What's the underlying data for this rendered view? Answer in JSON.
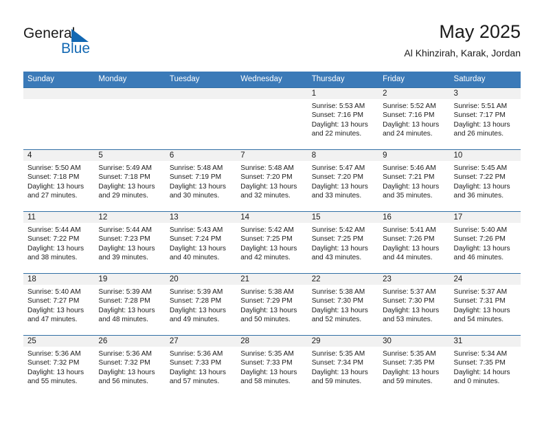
{
  "brand": {
    "name_part1": "General",
    "name_part2": "Blue",
    "flag_icon": "blue-triangle-flag-icon",
    "accent_color": "#1268b3"
  },
  "header": {
    "title": "May 2025",
    "subtitle": "Al Khinzirah, Karak, Jordan"
  },
  "theme": {
    "header_blue": "#3b7ab8",
    "row_border_blue": "#2e6da4",
    "day_band_gray": "#f1f1f1"
  },
  "calendar": {
    "weekday_headers": [
      "Sunday",
      "Monday",
      "Tuesday",
      "Wednesday",
      "Thursday",
      "Friday",
      "Saturday"
    ],
    "weeks": [
      [
        {
          "day": "",
          "empty": true
        },
        {
          "day": "",
          "empty": true
        },
        {
          "day": "",
          "empty": true
        },
        {
          "day": "",
          "empty": true
        },
        {
          "day": "1",
          "sunrise": "Sunrise: 5:53 AM",
          "sunset": "Sunset: 7:16 PM",
          "daylight1": "Daylight: 13 hours",
          "daylight2": "and 22 minutes."
        },
        {
          "day": "2",
          "sunrise": "Sunrise: 5:52 AM",
          "sunset": "Sunset: 7:16 PM",
          "daylight1": "Daylight: 13 hours",
          "daylight2": "and 24 minutes."
        },
        {
          "day": "3",
          "sunrise": "Sunrise: 5:51 AM",
          "sunset": "Sunset: 7:17 PM",
          "daylight1": "Daylight: 13 hours",
          "daylight2": "and 26 minutes."
        }
      ],
      [
        {
          "day": "4",
          "sunrise": "Sunrise: 5:50 AM",
          "sunset": "Sunset: 7:18 PM",
          "daylight1": "Daylight: 13 hours",
          "daylight2": "and 27 minutes."
        },
        {
          "day": "5",
          "sunrise": "Sunrise: 5:49 AM",
          "sunset": "Sunset: 7:18 PM",
          "daylight1": "Daylight: 13 hours",
          "daylight2": "and 29 minutes."
        },
        {
          "day": "6",
          "sunrise": "Sunrise: 5:48 AM",
          "sunset": "Sunset: 7:19 PM",
          "daylight1": "Daylight: 13 hours",
          "daylight2": "and 30 minutes."
        },
        {
          "day": "7",
          "sunrise": "Sunrise: 5:48 AM",
          "sunset": "Sunset: 7:20 PM",
          "daylight1": "Daylight: 13 hours",
          "daylight2": "and 32 minutes."
        },
        {
          "day": "8",
          "sunrise": "Sunrise: 5:47 AM",
          "sunset": "Sunset: 7:20 PM",
          "daylight1": "Daylight: 13 hours",
          "daylight2": "and 33 minutes."
        },
        {
          "day": "9",
          "sunrise": "Sunrise: 5:46 AM",
          "sunset": "Sunset: 7:21 PM",
          "daylight1": "Daylight: 13 hours",
          "daylight2": "and 35 minutes."
        },
        {
          "day": "10",
          "sunrise": "Sunrise: 5:45 AM",
          "sunset": "Sunset: 7:22 PM",
          "daylight1": "Daylight: 13 hours",
          "daylight2": "and 36 minutes."
        }
      ],
      [
        {
          "day": "11",
          "sunrise": "Sunrise: 5:44 AM",
          "sunset": "Sunset: 7:22 PM",
          "daylight1": "Daylight: 13 hours",
          "daylight2": "and 38 minutes."
        },
        {
          "day": "12",
          "sunrise": "Sunrise: 5:44 AM",
          "sunset": "Sunset: 7:23 PM",
          "daylight1": "Daylight: 13 hours",
          "daylight2": "and 39 minutes."
        },
        {
          "day": "13",
          "sunrise": "Sunrise: 5:43 AM",
          "sunset": "Sunset: 7:24 PM",
          "daylight1": "Daylight: 13 hours",
          "daylight2": "and 40 minutes."
        },
        {
          "day": "14",
          "sunrise": "Sunrise: 5:42 AM",
          "sunset": "Sunset: 7:25 PM",
          "daylight1": "Daylight: 13 hours",
          "daylight2": "and 42 minutes."
        },
        {
          "day": "15",
          "sunrise": "Sunrise: 5:42 AM",
          "sunset": "Sunset: 7:25 PM",
          "daylight1": "Daylight: 13 hours",
          "daylight2": "and 43 minutes."
        },
        {
          "day": "16",
          "sunrise": "Sunrise: 5:41 AM",
          "sunset": "Sunset: 7:26 PM",
          "daylight1": "Daylight: 13 hours",
          "daylight2": "and 44 minutes."
        },
        {
          "day": "17",
          "sunrise": "Sunrise: 5:40 AM",
          "sunset": "Sunset: 7:26 PM",
          "daylight1": "Daylight: 13 hours",
          "daylight2": "and 46 minutes."
        }
      ],
      [
        {
          "day": "18",
          "sunrise": "Sunrise: 5:40 AM",
          "sunset": "Sunset: 7:27 PM",
          "daylight1": "Daylight: 13 hours",
          "daylight2": "and 47 minutes."
        },
        {
          "day": "19",
          "sunrise": "Sunrise: 5:39 AM",
          "sunset": "Sunset: 7:28 PM",
          "daylight1": "Daylight: 13 hours",
          "daylight2": "and 48 minutes."
        },
        {
          "day": "20",
          "sunrise": "Sunrise: 5:39 AM",
          "sunset": "Sunset: 7:28 PM",
          "daylight1": "Daylight: 13 hours",
          "daylight2": "and 49 minutes."
        },
        {
          "day": "21",
          "sunrise": "Sunrise: 5:38 AM",
          "sunset": "Sunset: 7:29 PM",
          "daylight1": "Daylight: 13 hours",
          "daylight2": "and 50 minutes."
        },
        {
          "day": "22",
          "sunrise": "Sunrise: 5:38 AM",
          "sunset": "Sunset: 7:30 PM",
          "daylight1": "Daylight: 13 hours",
          "daylight2": "and 52 minutes."
        },
        {
          "day": "23",
          "sunrise": "Sunrise: 5:37 AM",
          "sunset": "Sunset: 7:30 PM",
          "daylight1": "Daylight: 13 hours",
          "daylight2": "and 53 minutes."
        },
        {
          "day": "24",
          "sunrise": "Sunrise: 5:37 AM",
          "sunset": "Sunset: 7:31 PM",
          "daylight1": "Daylight: 13 hours",
          "daylight2": "and 54 minutes."
        }
      ],
      [
        {
          "day": "25",
          "sunrise": "Sunrise: 5:36 AM",
          "sunset": "Sunset: 7:32 PM",
          "daylight1": "Daylight: 13 hours",
          "daylight2": "and 55 minutes."
        },
        {
          "day": "26",
          "sunrise": "Sunrise: 5:36 AM",
          "sunset": "Sunset: 7:32 PM",
          "daylight1": "Daylight: 13 hours",
          "daylight2": "and 56 minutes."
        },
        {
          "day": "27",
          "sunrise": "Sunrise: 5:36 AM",
          "sunset": "Sunset: 7:33 PM",
          "daylight1": "Daylight: 13 hours",
          "daylight2": "and 57 minutes."
        },
        {
          "day": "28",
          "sunrise": "Sunrise: 5:35 AM",
          "sunset": "Sunset: 7:33 PM",
          "daylight1": "Daylight: 13 hours",
          "daylight2": "and 58 minutes."
        },
        {
          "day": "29",
          "sunrise": "Sunrise: 5:35 AM",
          "sunset": "Sunset: 7:34 PM",
          "daylight1": "Daylight: 13 hours",
          "daylight2": "and 59 minutes."
        },
        {
          "day": "30",
          "sunrise": "Sunrise: 5:35 AM",
          "sunset": "Sunset: 7:35 PM",
          "daylight1": "Daylight: 13 hours",
          "daylight2": "and 59 minutes."
        },
        {
          "day": "31",
          "sunrise": "Sunrise: 5:34 AM",
          "sunset": "Sunset: 7:35 PM",
          "daylight1": "Daylight: 14 hours",
          "daylight2": "and 0 minutes."
        }
      ]
    ]
  }
}
